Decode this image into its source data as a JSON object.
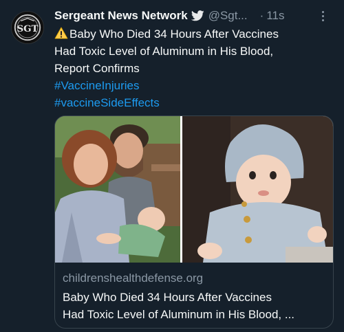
{
  "tweet": {
    "display_name": "Sergeant News Network",
    "handle": "@Sgt...",
    "separator": "·",
    "time": "11s",
    "avatar_text": "SGT",
    "body_lines": [
      "Baby Who Died 34 Hours After Vaccines",
      "Had Toxic Level of Aluminum in His Blood,",
      "Report Confirms"
    ],
    "hashtags": [
      "#VaccineInjuries",
      "#vaccineSideEffects"
    ],
    "icons": {
      "verified": "twitter-bird-icon",
      "warning": "warning-icon",
      "more": "more-icon"
    }
  },
  "card": {
    "domain": "childrenshealthdefense.org",
    "title_lines": [
      "Baby Who Died 34 Hours After Vaccines",
      "Had Toxic Level of Aluminum in His Blood, ..."
    ]
  },
  "colors": {
    "background": "#15202b",
    "text": "#f7f9f9",
    "secondary": "#8b98a5",
    "link": "#1d9bf0",
    "border": "#38444d"
  }
}
